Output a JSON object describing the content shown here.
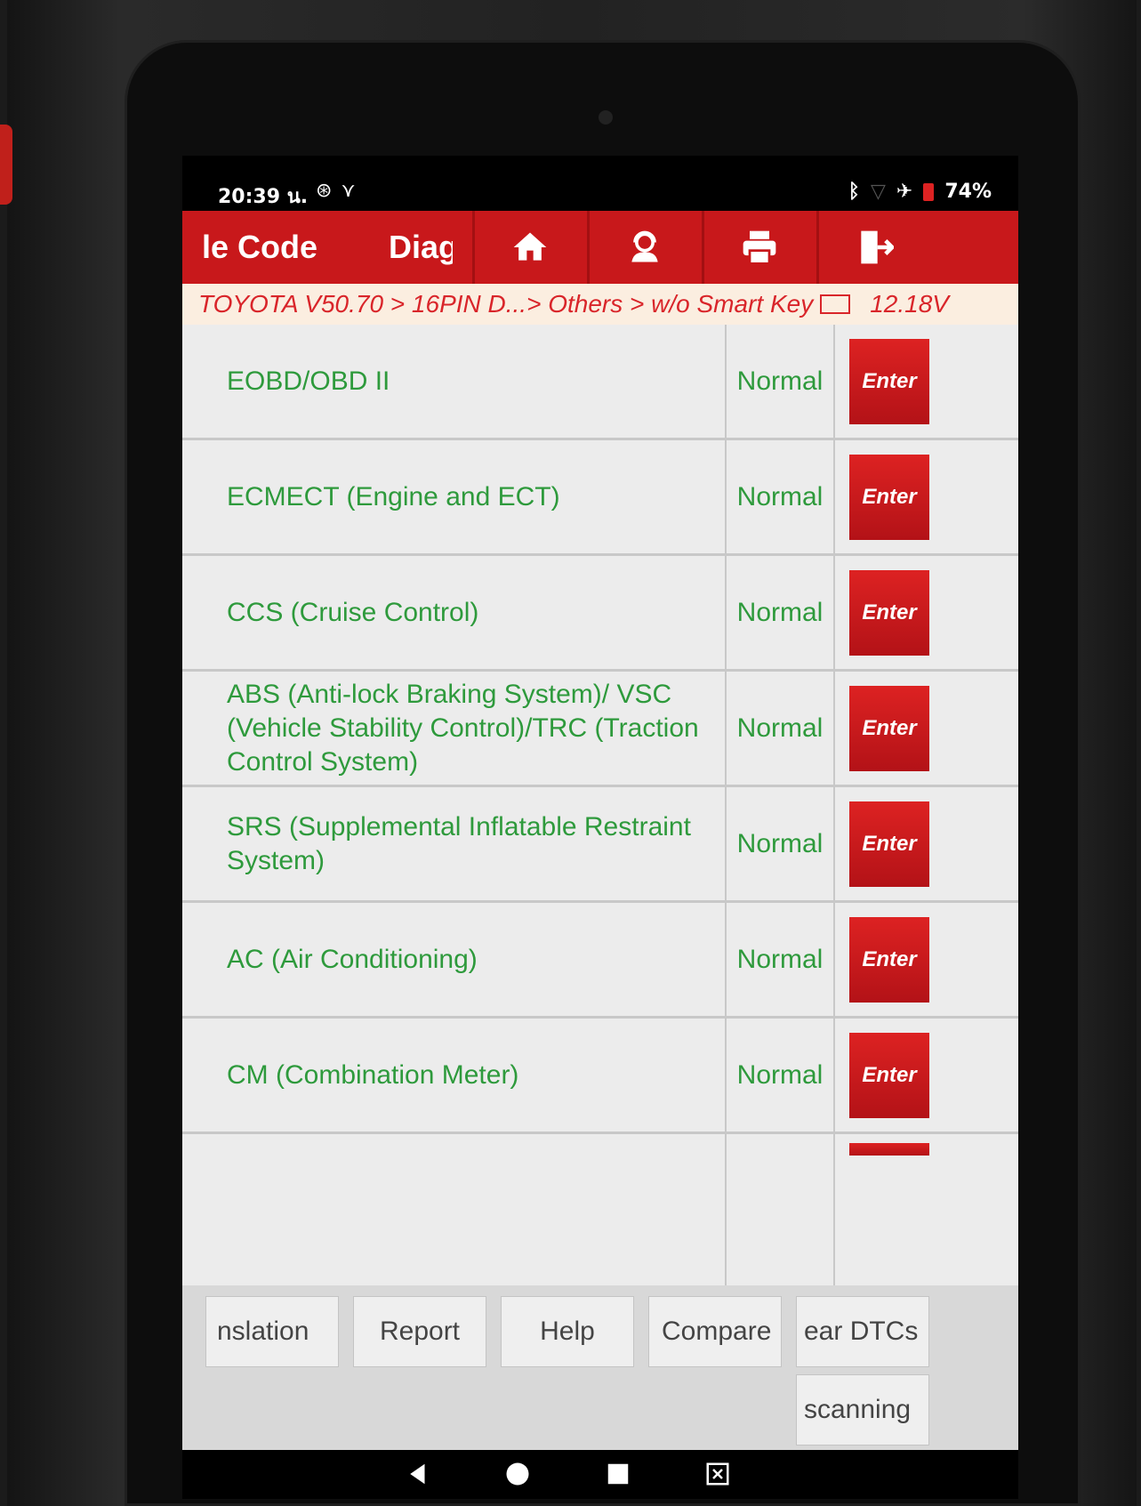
{
  "status_bar": {
    "time": "20:39 น.",
    "left_icons": [
      "settings-dot-icon",
      "usb-debug-icon"
    ],
    "right_icons": [
      "bluetooth-icon",
      "signal-icon",
      "airplane-icon",
      "battery-icon"
    ],
    "battery": "74%"
  },
  "header": {
    "title_partial": "le Code",
    "title_partial_2": "Diag",
    "buttons": [
      "home-icon",
      "support-icon",
      "print-icon",
      "exit-icon"
    ]
  },
  "breadcrumb": {
    "path": "TOYOTA V50.70 > 16PIN D...> Others > w/o Smart Key",
    "voltage": "12.18V"
  },
  "systems": [
    {
      "name": "EOBD/OBD II",
      "status": "Normal",
      "action": "Enter"
    },
    {
      "name": "ECMECT (Engine and ECT)",
      "status": "Normal",
      "action": "Enter"
    },
    {
      "name": "CCS (Cruise Control)",
      "status": "Normal",
      "action": "Enter"
    },
    {
      "name": "ABS (Anti-lock Braking System)/ VSC (Vehicle Stability Control)/TRC (Traction Control System)",
      "status": "Normal",
      "action": "Enter"
    },
    {
      "name": "SRS (Supplemental Inflatable Restraint System)",
      "status": "Normal",
      "action": "Enter"
    },
    {
      "name": "AC (Air Conditioning)",
      "status": "Normal",
      "action": "Enter"
    },
    {
      "name": "CM (Combination Meter)",
      "status": "Normal",
      "action": "Enter"
    }
  ],
  "bottom_buttons": {
    "translation": "nslation",
    "report": "Report",
    "help": "Help",
    "compare": "Compare",
    "clear_dtcs": "ear DTCs",
    "rescanning": "scanning"
  },
  "nav_bar": [
    "back-icon",
    "home-circle-icon",
    "recents-icon",
    "screenshot-icon"
  ],
  "colors": {
    "header_red": "#c8181b",
    "list_text_green": "#2e9a3c",
    "breadcrumb_bg": "#fbeee0",
    "breadcrumb_text": "#d9252a"
  }
}
